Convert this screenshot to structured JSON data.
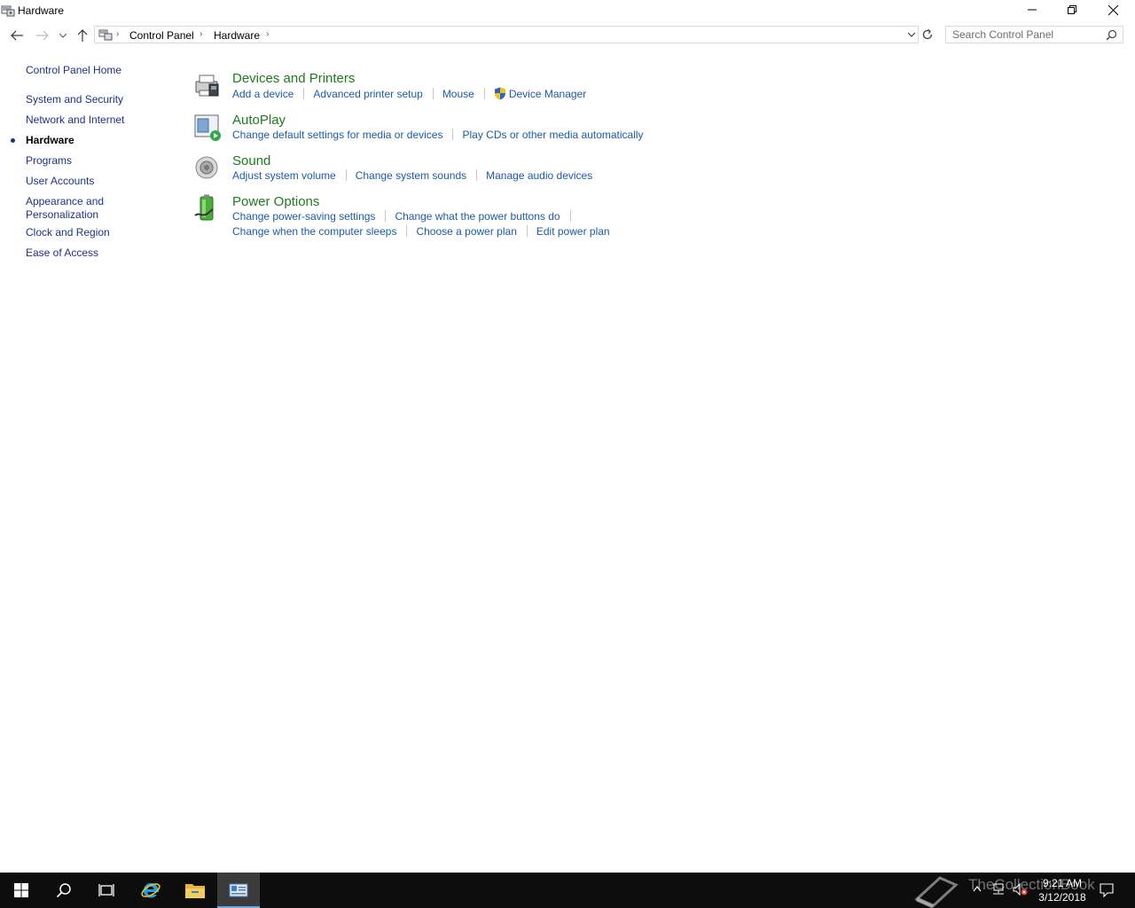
{
  "window": {
    "title": "Hardware",
    "controls": {
      "minimize_icon": "minimize-icon",
      "restore_icon": "restore-icon",
      "close_icon": "close-icon"
    }
  },
  "navigation": {
    "back_icon": "back-arrow-icon",
    "forward_icon": "forward-arrow-icon",
    "recent_icon": "chevron-down-icon",
    "up_icon": "up-arrow-icon",
    "breadcrumb": [
      "Control Panel",
      "Hardware"
    ],
    "refresh_icon": "refresh-icon",
    "search": {
      "placeholder": "Search Control Panel"
    }
  },
  "sidebar": {
    "home": "Control Panel Home",
    "items": [
      {
        "label": "System and Security",
        "current": false
      },
      {
        "label": "Network and Internet",
        "current": false
      },
      {
        "label": "Hardware",
        "current": true
      },
      {
        "label": "Programs",
        "current": false
      },
      {
        "label": "User Accounts",
        "current": false
      },
      {
        "label": "Appearance and Personalization",
        "current": false
      },
      {
        "label": "Clock and Region",
        "current": false
      },
      {
        "label": "Ease of Access",
        "current": false
      }
    ]
  },
  "categories": [
    {
      "title": "Devices and Printers",
      "icon": "printer-icon",
      "links": [
        "Add a device",
        "Advanced printer setup",
        "Mouse",
        "Device Manager"
      ]
    },
    {
      "title": "AutoPlay",
      "icon": "autoplay-icon",
      "links": [
        "Change default settings for media or devices",
        "Play CDs or other media automatically"
      ]
    },
    {
      "title": "Sound",
      "icon": "speaker-icon",
      "links": [
        "Adjust system volume",
        "Change system sounds",
        "Manage audio devices"
      ]
    },
    {
      "title": "Power Options",
      "icon": "battery-icon",
      "links": [
        "Change power-saving settings",
        "Change what the power buttons do"
      ],
      "links2": [
        "Change when the computer sleeps",
        "Choose a power plan",
        "Edit power plan"
      ]
    }
  ],
  "taskbar": {
    "items": [
      "start-icon",
      "search-icon",
      "task-view-icon",
      "internet-explorer-icon",
      "file-explorer-icon",
      "control-panel-icon"
    ],
    "clock": {
      "time": "9:21 AM",
      "date": "3/12/2018"
    },
    "watermark": "TheCollectionBook"
  },
  "colors": {
    "category_title": "#1e7b1e",
    "link": "#1e5aa8",
    "nav_link": "#1e3287",
    "taskbar": "#0d0d0d"
  }
}
